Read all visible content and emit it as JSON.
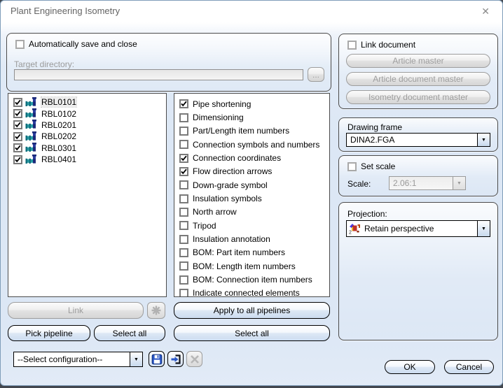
{
  "window": {
    "title": "Plant Engineering Isometry"
  },
  "icons": {
    "close": "✕",
    "dropdown_arrow": "▼",
    "browse_ellipsis": "..."
  },
  "colors": {
    "dialog_border": "#7f9db9",
    "body_tint": "#dce7f5",
    "disabled_text": "#9d9d9d",
    "pipe_teal": "#2aa0a8",
    "pipe_navy": "#243394",
    "accent_blue": "#2a56c6"
  },
  "save_group": {
    "auto_save_label": "Automatically save and close",
    "auto_save_checked": false,
    "target_dir_label": "Target directory:",
    "target_dir_value": "",
    "browse_label": "..."
  },
  "pipeline_list": {
    "items": [
      {
        "name": "RBL0101",
        "checked": true,
        "selected": true
      },
      {
        "name": "RBL0102",
        "checked": true,
        "selected": false
      },
      {
        "name": "RBL0201",
        "checked": true,
        "selected": false
      },
      {
        "name": "RBL0202",
        "checked": true,
        "selected": false
      },
      {
        "name": "RBL0301",
        "checked": true,
        "selected": false
      },
      {
        "name": "RBL0401",
        "checked": true,
        "selected": false
      }
    ]
  },
  "option_list": {
    "items": [
      {
        "label": "Pipe shortening",
        "checked": true
      },
      {
        "label": "Dimensioning",
        "checked": false
      },
      {
        "label": "Part/Length item numbers",
        "checked": false
      },
      {
        "label": "Connection symbols and numbers",
        "checked": false
      },
      {
        "label": "Connection coordinates",
        "checked": true
      },
      {
        "label": "Flow direction arrows",
        "checked": true
      },
      {
        "label": "Down-grade symbol",
        "checked": false
      },
      {
        "label": "Insulation symbols",
        "checked": false
      },
      {
        "label": "North arrow",
        "checked": false
      },
      {
        "label": "Tripod",
        "checked": false
      },
      {
        "label": "Insulation annotation",
        "checked": false
      },
      {
        "label": "BOM: Part item numbers",
        "checked": false
      },
      {
        "label": "BOM: Length item numbers",
        "checked": false
      },
      {
        "label": "BOM: Connection item numbers",
        "checked": false
      },
      {
        "label": "Indicate connected elements",
        "checked": false
      }
    ]
  },
  "link_document_group": {
    "checkbox_label": "Link document",
    "checkbox_checked": false,
    "article_master": "Article master",
    "article_document_master": "Article document master",
    "isometry_document_master": "Isometry document master"
  },
  "drawing_frame_group": {
    "label": "Drawing frame",
    "value": "DINA2.FGA"
  },
  "scale_group": {
    "checkbox_label": "Set scale",
    "checkbox_checked": false,
    "scale_label": "Scale:",
    "value": "2.06:1"
  },
  "projection_group": {
    "label": "Projection:",
    "value": "Retain perspective"
  },
  "pipeline_actions": {
    "link": "Link",
    "pick_pipeline": "Pick pipeline",
    "select_all": "Select all"
  },
  "option_actions": {
    "apply_all": "Apply to all pipelines",
    "select_all": "Select all"
  },
  "configuration": {
    "value": "--Select configuration--"
  },
  "dialog_actions": {
    "ok": "OK",
    "cancel": "Cancel"
  }
}
